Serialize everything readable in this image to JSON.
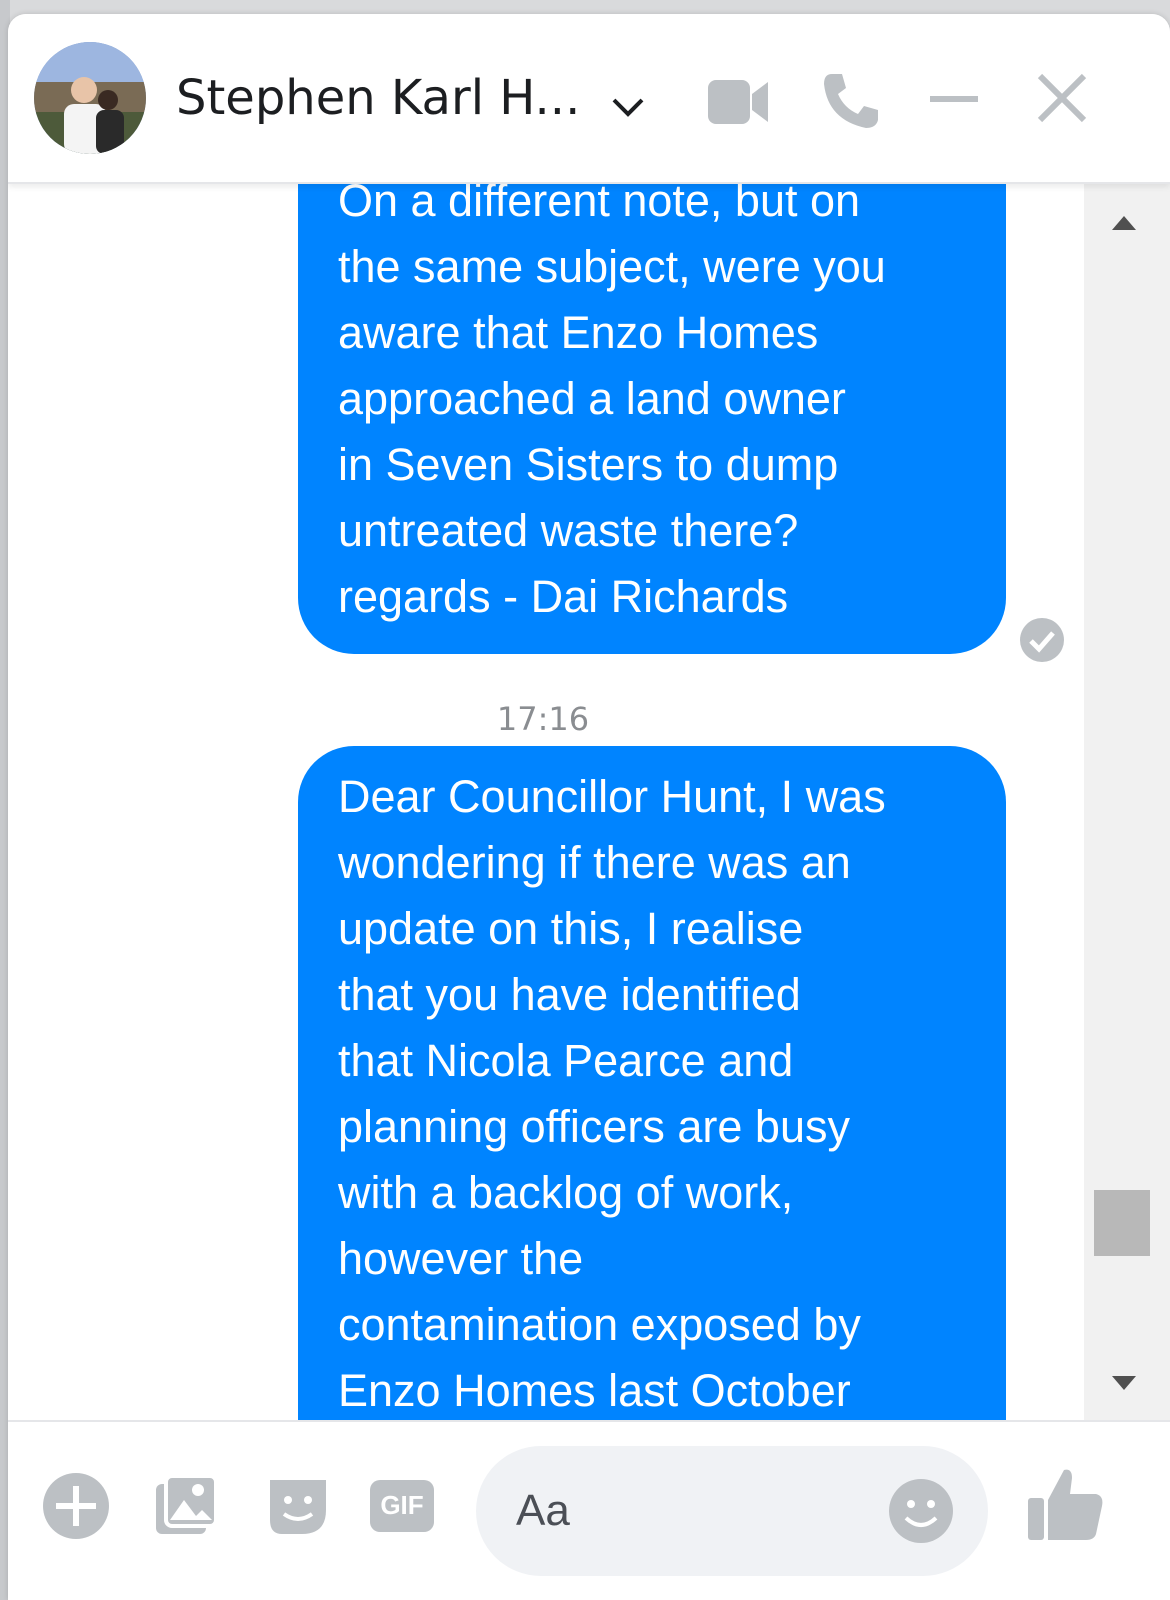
{
  "header": {
    "contact_name": "Stephen Karl H...",
    "icons": [
      "chevron-down-icon",
      "video-call-icon",
      "phone-call-icon",
      "minimize-icon",
      "close-icon"
    ]
  },
  "messages": [
    {
      "direction": "outgoing",
      "text": "On a different note, but on\nthe same subject, were you\naware that Enzo Homes\napproached a land owner\nin Seven Sisters to dump\nuntreated waste there?\nregards - Dai Richards",
      "status_icon": "seen-check-icon"
    },
    {
      "timestamp": "17:16"
    },
    {
      "direction": "outgoing",
      "text": "Dear Councillor Hunt, I was\nwondering if there was an\nupdate on this, I realise\nthat you have identified\nthat Nicola Pearce and\nplanning officers are busy\nwith a backlog of work,\nhowever the\ncontamination exposed by\nEnzo Homes last October"
    }
  ],
  "composer": {
    "placeholder": "Aa",
    "tools": [
      "plus-icon",
      "photo-icon",
      "sticker-icon",
      "gif-icon",
      "emoji-icon",
      "like-icon"
    ],
    "gif_label": "GIF"
  },
  "colors": {
    "bubble": "#0084ff",
    "icon_gray": "#bcc0c4"
  }
}
